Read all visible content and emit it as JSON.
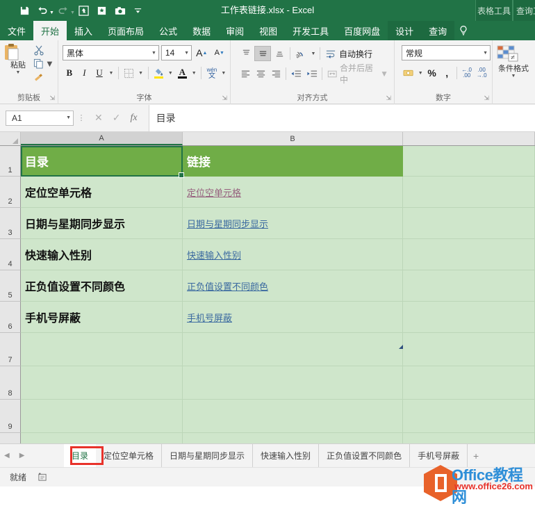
{
  "window": {
    "title": "工作表链接.xlsx - Excel",
    "accent_color": "#217346",
    "quick_access": [
      {
        "name": "save-icon",
        "label": "保存"
      },
      {
        "name": "undo-icon",
        "label": "撤销"
      },
      {
        "name": "redo-icon",
        "label": "恢复"
      },
      {
        "name": "quick-print-icon",
        "label": "快速打印"
      },
      {
        "name": "new-icon",
        "label": "新建"
      },
      {
        "name": "camera-icon",
        "label": "照相机"
      },
      {
        "name": "customize-qat-icon",
        "label": "自定义快速访问工具栏"
      }
    ],
    "contextual_groups": [
      {
        "name": "表格工具",
        "tab": "设计"
      },
      {
        "name": "查询工具",
        "tab": "查询"
      }
    ]
  },
  "ribbon": {
    "tabs": [
      {
        "label": "文件",
        "active": false
      },
      {
        "label": "开始",
        "active": true
      },
      {
        "label": "插入",
        "active": false
      },
      {
        "label": "页面布局",
        "active": false
      },
      {
        "label": "公式",
        "active": false
      },
      {
        "label": "数据",
        "active": false
      },
      {
        "label": "审阅",
        "active": false
      },
      {
        "label": "视图",
        "active": false
      },
      {
        "label": "开发工具",
        "active": false
      },
      {
        "label": "百度网盘",
        "active": false
      },
      {
        "label": "设计",
        "active": false
      },
      {
        "label": "查询",
        "active": false
      }
    ],
    "tell_me_icon": "lightbulb-icon",
    "groups": {
      "clipboard": {
        "label": "剪贴板",
        "paste_label": "粘贴",
        "cut_label": "剪切",
        "copy_label": "复制",
        "format_painter_label": "格式刷"
      },
      "font": {
        "label": "字体",
        "font_name": "黑体",
        "font_size": "14",
        "grow_label": "增大字号",
        "shrink_label": "减小字号",
        "bold_label": "B",
        "italic_label": "I",
        "underline_label": "U",
        "borders_label": "边框",
        "fill_label": "填充颜色",
        "fontcolor_label": "字体颜色",
        "phonetic_label": "wén 文"
      },
      "alignment": {
        "label": "对齐方式",
        "wrap_text_label": "自动换行",
        "merge_center_label": "合并后居中",
        "merge_center_disabled": true
      },
      "number": {
        "label": "数字",
        "format_value": "常规",
        "percent_label": "%",
        "comma_label": ",",
        "increase_decimal_label": ".00",
        "decrease_decimal_label": ".00"
      },
      "styles": {
        "conditional_formatting_label": "条件格式"
      }
    }
  },
  "formula_bar": {
    "name_box": "A1",
    "cancel_icon": "close-icon",
    "confirm_icon": "check-icon",
    "function_icon": "fx-icon",
    "content": "目录"
  },
  "grid": {
    "column_headers": [
      "A",
      "B",
      ""
    ],
    "selected_cell": "A1",
    "columns": {
      "a_width": 233,
      "b_width": 317
    },
    "rows": [
      {
        "number": "1",
        "a": "目录",
        "b": "链接",
        "type": "header"
      },
      {
        "number": "2",
        "a": "定位空单元格",
        "b": "定位空单元格",
        "type": "data",
        "link_state": "visited"
      },
      {
        "number": "3",
        "a": "日期与星期同步显示",
        "b": "日期与星期同步显示",
        "type": "data",
        "link_state": "unvisited"
      },
      {
        "number": "4",
        "a": "快速输入性别",
        "b": "快速输入性别",
        "type": "data",
        "link_state": "unvisited"
      },
      {
        "number": "5",
        "a": "正负值设置不同颜色",
        "b": "正负值设置不同颜色",
        "type": "data",
        "link_state": "unvisited"
      },
      {
        "number": "6",
        "a": "手机号屏蔽",
        "b": "手机号屏蔽",
        "type": "data",
        "link_state": "unvisited"
      },
      {
        "number": "7",
        "a": "",
        "b": "",
        "type": "empty"
      },
      {
        "number": "8",
        "a": "",
        "b": "",
        "type": "empty"
      },
      {
        "number": "9",
        "a": "",
        "b": "",
        "type": "empty"
      }
    ],
    "header_fill": "#70AD47",
    "body_fill": "#CFE6CB",
    "visited_link_color": "#96607E",
    "link_color": "#3B6AA0"
  },
  "sheet_tabs": {
    "prev_icon": "chevron-left-icon",
    "next_icon": "chevron-right-icon",
    "add_label": "+",
    "highlight_color": "#E8322A",
    "tabs": [
      {
        "label": "目录",
        "active": true
      },
      {
        "label": "定位空单元格",
        "active": false
      },
      {
        "label": "日期与星期同步显示",
        "active": false
      },
      {
        "label": "快速输入性别",
        "active": false
      },
      {
        "label": "正负值设置不同颜色",
        "active": false
      },
      {
        "label": "手机号屏蔽",
        "active": false
      }
    ]
  },
  "status_bar": {
    "status": "就绪",
    "macro_icon": "record-macro-icon"
  },
  "watermark": {
    "brand": "Office教程网",
    "url": "www.office26.com",
    "logo_icon": "office-logo-icon"
  }
}
